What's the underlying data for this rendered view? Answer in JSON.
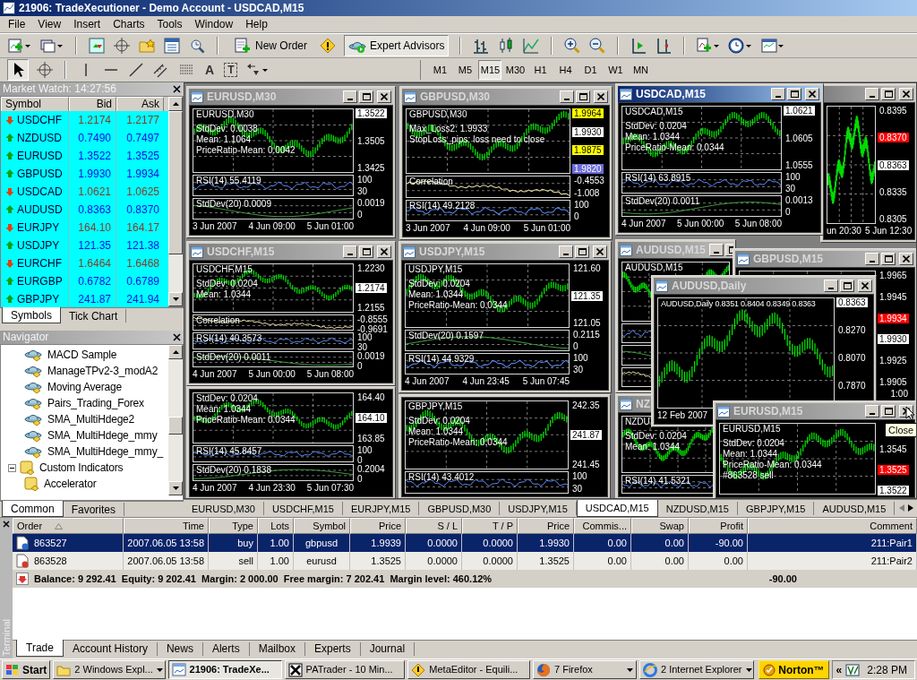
{
  "window": {
    "title": "21906: TradeXecutioner - Demo Account - USDCAD,M15"
  },
  "menu": [
    "File",
    "View",
    "Insert",
    "Charts",
    "Tools",
    "Window",
    "Help"
  ],
  "toolbar": {
    "buttons": [
      {
        "label": "New Order",
        "pressed": false
      },
      {
        "label": "Expert Advisors",
        "pressed": true
      }
    ]
  },
  "drawing_tools": [
    {
      "label": "A",
      "kind": "plain"
    },
    {
      "label": "T",
      "kind": "boxed"
    }
  ],
  "periods": [
    {
      "label": "M1",
      "selected": false
    },
    {
      "label": "M5",
      "selected": false
    },
    {
      "label": "M15",
      "selected": true
    },
    {
      "label": "M30",
      "selected": false
    },
    {
      "label": "H1",
      "selected": false
    },
    {
      "label": "H4",
      "selected": false
    },
    {
      "label": "D1",
      "selected": false
    },
    {
      "label": "W1",
      "selected": false
    },
    {
      "label": "MN",
      "selected": false
    }
  ],
  "market_watch": {
    "title": "Market Watch: 14:27:56",
    "columns": [
      "Symbol",
      "Bid",
      "Ask"
    ],
    "rows": [
      {
        "symbol": "USDCHF",
        "rising": false,
        "bid": "1.2174",
        "ask": "1.2177"
      },
      {
        "symbol": "NZDUSD",
        "rising": true,
        "bid": "0.7490",
        "ask": "0.7497"
      },
      {
        "symbol": "EURUSD",
        "rising": true,
        "bid": "1.3522",
        "ask": "1.3525"
      },
      {
        "symbol": "GBPUSD",
        "rising": true,
        "bid": "1.9930",
        "ask": "1.9934"
      },
      {
        "symbol": "USDCAD",
        "rising": false,
        "bid": "1.0621",
        "ask": "1.0625"
      },
      {
        "symbol": "AUDUSD",
        "rising": true,
        "bid": "0.8363",
        "ask": "0.8370"
      },
      {
        "symbol": "EURJPY",
        "rising": false,
        "bid": "164.10",
        "ask": "164.17"
      },
      {
        "symbol": "USDJPY",
        "rising": true,
        "bid": "121.35",
        "ask": "121.38"
      },
      {
        "symbol": "EURCHF",
        "rising": false,
        "bid": "1.6464",
        "ask": "1.6468"
      },
      {
        "symbol": "EURGBP",
        "rising": true,
        "bid": "0.6782",
        "ask": "0.6789"
      },
      {
        "symbol": "GBPJPY",
        "rising": true,
        "bid": "241.87",
        "ask": "241.94"
      }
    ],
    "tabs": [
      {
        "label": "Symbols",
        "selected": true
      },
      {
        "label": "Tick Chart",
        "selected": false
      }
    ]
  },
  "navigator": {
    "title": "Navigator",
    "items": [
      {
        "label": "MACD Sample",
        "kind": "expert"
      },
      {
        "label": "ManageTPv2-3_modA2",
        "kind": "expert"
      },
      {
        "label": "Moving Average",
        "kind": "expert"
      },
      {
        "label": "Pairs_Trading_Forex",
        "kind": "expert"
      },
      {
        "label": "SMA_MultiHdege2",
        "kind": "expert"
      },
      {
        "label": "SMA_MultiHdege_mmy",
        "kind": "expert"
      },
      {
        "label": "SMA_MultiHdege_mmy_",
        "kind": "expert"
      },
      {
        "label": "Custom Indicators",
        "kind": "folder",
        "expanded": true,
        "children": [
          {
            "label": "Accelerator",
            "kind": "indicator"
          }
        ]
      }
    ],
    "tabs": [
      {
        "label": "Common",
        "selected": true
      },
      {
        "label": "Favorites",
        "selected": false
      }
    ]
  },
  "charts": [
    {
      "title": "EURUSD,M30",
      "active": false,
      "panes": [
        {
          "kind": "main",
          "header": "EURUSD,M30",
          "lines": [
            "StdDev: 0.0038",
            "Mean: 1.1064",
            "PriceRatio-Mean: 0.0042"
          ],
          "prices": [
            {
              "text": "1.3522",
              "kind": "current"
            },
            {
              "text": "1.3505",
              "kind": "plain"
            },
            {
              "text": "1.3425",
              "kind": "plain"
            }
          ]
        },
        {
          "kind": "rsi",
          "label": "RSI(14) 55.4119",
          "prices": [
            {
              "text": "100",
              "kind": "plain"
            },
            {
              "text": "30",
              "kind": "plain"
            }
          ]
        },
        {
          "kind": "stddev",
          "label": "StdDev(20) 0.0009",
          "prices": [
            {
              "text": "0.0019",
              "kind": "plain"
            },
            {
              "text": "0",
              "kind": "plain"
            }
          ]
        }
      ],
      "dates": [
        "3 Jun 2007",
        "4 Jun 09:00",
        "5 Jun 01:00"
      ]
    },
    {
      "title": "GBPUSD,M30",
      "active": false,
      "panes": [
        {
          "kind": "main",
          "header": "GBPUSD,M30",
          "lines": [
            "Max_Loss2: 1.9933",
            "StopLoss_pips: loss need to close"
          ],
          "prices": [
            {
              "text": "1.9964",
              "kind": "yellow"
            },
            {
              "text": "1.9930",
              "kind": "current"
            },
            {
              "text": "1.9875",
              "kind": "yellow"
            },
            {
              "text": "1.9820",
              "kind": "purple"
            }
          ]
        },
        {
          "kind": "correlation",
          "label": "Correlation",
          "prices": [
            {
              "text": "-0.4553",
              "kind": "plain"
            },
            {
              "text": "-1.008",
              "kind": "plain"
            }
          ]
        },
        {
          "kind": "rsi",
          "label": "RSI(14) 49.2128",
          "prices": [
            {
              "text": "100",
              "kind": "plain"
            },
            {
              "text": "0",
              "kind": "plain"
            }
          ]
        }
      ],
      "dates": [
        "3 Jun 2007",
        "4 Jun 09:00",
        "5 Jun 01:00"
      ]
    },
    {
      "title": "USDCAD,M15",
      "active": true,
      "panes": [
        {
          "kind": "main",
          "header": "USDCAD,M15",
          "lines": [
            "StdDev: 0.0204",
            "Mean: 1.0344",
            "PriceRatio-Mean: 0.0344"
          ],
          "prices": [
            {
              "text": "1.0621",
              "kind": "current"
            },
            {
              "text": "1.0605",
              "kind": "plain"
            },
            {
              "text": "1.0555",
              "kind": "plain"
            }
          ]
        },
        {
          "kind": "rsi",
          "label": "RSI(14) 63.8915",
          "prices": [
            {
              "text": "100",
              "kind": "plain"
            },
            {
              "text": "30",
              "kind": "plain"
            }
          ]
        },
        {
          "kind": "stddev",
          "label": "StdDev(20) 0.0011",
          "prices": [
            {
              "text": "0.0013",
              "kind": "plain"
            },
            {
              "text": "0",
              "kind": "plain"
            }
          ]
        }
      ],
      "dates": [
        "4 Jun 2007",
        "5 Jun 00:00",
        "5 Jun 08:00"
      ]
    },
    {
      "active": false,
      "panes": [
        {
          "kind": "main",
          "prices": [
            {
              "text": "0.8395",
              "kind": "plain"
            },
            {
              "text": "0.8370",
              "kind": "red"
            },
            {
              "text": "0.8363",
              "kind": "current"
            },
            {
              "text": "0.8335",
              "kind": "plain"
            },
            {
              "text": "0.8305",
              "kind": "plain"
            }
          ]
        }
      ],
      "dates": [
        "un 20:30",
        "5 Jun 12:30"
      ]
    },
    {
      "title": "USDCHF,M15",
      "active": false,
      "panes": [
        {
          "kind": "main",
          "header": "USDCHF,M15",
          "lines": [
            "StdDev: 0.0204",
            "Mean: 1.0344"
          ],
          "prices": [
            {
              "text": "1.2230",
              "kind": "plain"
            },
            {
              "text": "1.2174",
              "kind": "current"
            },
            {
              "text": "1.2155",
              "kind": "plain"
            }
          ]
        },
        {
          "kind": "correlation",
          "label": "Correlation",
          "prices": [
            {
              "text": "-0.8555",
              "kind": "plain"
            },
            {
              "text": "-0.9691",
              "kind": "plain"
            }
          ]
        },
        {
          "kind": "rsi",
          "label": "RSI(14) 40.3573",
          "prices": [
            {
              "text": "100",
              "kind": "plain"
            },
            {
              "text": "30",
              "kind": "plain"
            }
          ]
        },
        {
          "kind": "stddev",
          "label": "StdDev(20) 0.0011",
          "prices": [
            {
              "text": "0.0019",
              "kind": "plain"
            },
            {
              "text": "0",
              "kind": "plain"
            }
          ]
        }
      ],
      "dates": [
        "4 Jun 2007",
        "5 Jun 00:00",
        "5 Jun 08:00"
      ]
    },
    {
      "title": "USDJPY,M15",
      "active": false,
      "panes": [
        {
          "kind": "main",
          "header": "USDJPY,M15",
          "lines": [
            "StdDev: 0.0204",
            "Mean: 1.0344",
            "PriceRatio-Mean: 0.0344"
          ],
          "prices": [
            {
              "text": "121.60",
              "kind": "plain"
            },
            {
              "text": "121.35",
              "kind": "current"
            },
            {
              "text": "121.05",
              "kind": "plain"
            }
          ]
        },
        {
          "kind": "stddev",
          "label": "StdDev(20) 0.1597",
          "prices": [
            {
              "text": "0.2115",
              "kind": "plain"
            },
            {
              "text": "0",
              "kind": "plain"
            }
          ]
        },
        {
          "kind": "rsi",
          "label": "RSI(14) 44.9329",
          "prices": [
            {
              "text": "100",
              "kind": "plain"
            },
            {
              "text": "30",
              "kind": "plain"
            }
          ]
        }
      ],
      "dates": [
        "4 Jun 2007",
        "4 Jun 23:45",
        "5 Jun 07:45"
      ]
    },
    {
      "title": "AUDUSD,M15",
      "active": false,
      "panes": [
        {
          "kind": "main",
          "header": "AUDUSD,M15"
        },
        {
          "kind": "rsi"
        },
        {
          "kind": "stddev"
        },
        {
          "kind": "correlation"
        }
      ]
    },
    {
      "title": "GBPUSD,M15",
      "active": false,
      "panes": [
        {
          "kind": "main",
          "prices": [
            {
              "text": "1.9965",
              "kind": "plain"
            },
            {
              "text": "1.9945",
              "kind": "plain"
            },
            {
              "text": "1.9934",
              "kind": "red"
            },
            {
              "text": "1.9930",
              "kind": "current"
            },
            {
              "text": "1.9925",
              "kind": "plain"
            },
            {
              "text": "1.9905",
              "kind": "plain"
            }
          ]
        }
      ],
      "dates": [
        "1:00"
      ]
    },
    {
      "title": "AUDUSD,Daily",
      "active": false,
      "panes": [
        {
          "kind": "main",
          "header": "AUDUSD,Daily 0.8351 0.8404 0.8349 0.8363",
          "prices": [
            {
              "text": "0.8363",
              "kind": "current"
            },
            {
              "text": "0.8270",
              "kind": "plain"
            },
            {
              "text": "0.8070",
              "kind": "plain"
            },
            {
              "text": "0.7870",
              "kind": "plain"
            }
          ]
        }
      ],
      "dates": [
        "12 Feb 2007"
      ]
    },
    {
      "panes": [
        {
          "kind": "main",
          "lines": [
            "StdDev: 0.0204",
            "Mean: 1.0344",
            "PriceRatio-Mean: 0.0344"
          ],
          "prices": [
            {
              "text": "164.40",
              "kind": "plain"
            },
            {
              "text": "164.10",
              "kind": "current"
            },
            {
              "text": "163.85",
              "kind": "plain"
            }
          ]
        },
        {
          "kind": "rsi",
          "label": "RSI(14) 45.8457",
          "prices": [
            {
              "text": "100",
              "kind": "plain"
            },
            {
              "text": "0",
              "kind": "plain"
            }
          ]
        },
        {
          "kind": "stddev",
          "label": "StdDev(20) 0.1838",
          "prices": [
            {
              "text": "0.2004",
              "kind": "plain"
            },
            {
              "text": "0",
              "kind": "plain"
            }
          ]
        }
      ],
      "dates": [
        "4 Jun 2007",
        "4 Jun 23:30",
        "5 Jun 07:30"
      ]
    },
    {
      "panes": [
        {
          "kind": "main",
          "header": "GBPJPY,M15",
          "lines": [
            "StdDev: 0.0204",
            "Mean: 1.0344",
            "PriceRatio-Mean: 0.0344"
          ],
          "prices": [
            {
              "text": "242.35",
              "kind": "plain"
            },
            {
              "text": "241.87",
              "kind": "current"
            },
            {
              "text": "241.45",
              "kind": "plain"
            }
          ]
        },
        {
          "kind": "rsi",
          "label": "RSI(14) 43.4012",
          "prices": [
            {
              "text": "100",
              "kind": "plain"
            },
            {
              "text": "30",
              "kind": "plain"
            }
          ]
        }
      ]
    },
    {
      "title": "NZ",
      "active": false,
      "panes": [
        {
          "kind": "main",
          "header": "NZDU",
          "lines": [
            "StdDev: 0.0204",
            "Mean: 1.0344"
          ]
        },
        {
          "kind": "rsi",
          "label": "RSI(14) 41.5321"
        }
      ]
    },
    {
      "title": "EURUSD,M15",
      "active": false,
      "panes": [
        {
          "kind": "main",
          "header": "EURUSD,M15",
          "lines": [
            "StdDev: 0.0204",
            "Mean: 1.0344",
            "PriceRatio-Mean: 0.0344",
            "#863528 sell"
          ],
          "prices": [
            {
              "text": "1.3545",
              "kind": "plain"
            },
            {
              "text": "1.3525",
              "kind": "red"
            },
            {
              "text": "1.3522",
              "kind": "current"
            }
          ]
        }
      ]
    }
  ],
  "tooltip": "Close",
  "chart_tabs": [
    {
      "label": "EURUSD,M30",
      "selected": false
    },
    {
      "label": "USDCHF,M15",
      "selected": false
    },
    {
      "label": "EURJPY,M15",
      "selected": false
    },
    {
      "label": "GBPUSD,M30",
      "selected": false
    },
    {
      "label": "USDJPY,M15",
      "selected": false
    },
    {
      "label": "USDCAD,M15",
      "selected": true
    },
    {
      "label": "NZDUSD,M15",
      "selected": false
    },
    {
      "label": "GBPJPY,M15",
      "selected": false
    },
    {
      "label": "AUDUSD,M15",
      "selected": false
    }
  ],
  "terminal": {
    "side_label": "Terminal",
    "columns": [
      "Order",
      "Time",
      "Type",
      "Lots",
      "Symbol",
      "Price",
      "S / L",
      "T / P",
      "Price",
      "Commis...",
      "Swap",
      "Profit",
      "Comment"
    ],
    "rows": [
      {
        "kind": "buy",
        "selected": true,
        "cells": [
          "863527",
          "2007.06.05 13:58",
          "buy",
          "1.00",
          "gbpusd",
          "1.9939",
          "0.0000",
          "0.0000",
          "1.9930",
          "0.00",
          "0.00",
          "-90.00",
          "211:Pair1"
        ]
      },
      {
        "kind": "sell",
        "selected": false,
        "cells": [
          "863528",
          "2007.06.05 13:58",
          "sell",
          "1.00",
          "eurusd",
          "1.3525",
          "0.0000",
          "0.0000",
          "1.3525",
          "0.00",
          "0.00",
          "0.00",
          "211:Pair2"
        ]
      }
    ],
    "summary": "Balance: 9 292.41  Equity: 9 202.41  Margin: 2 000.00  Free margin: 7 202.41  Margin level: 460.12%",
    "summary_profit": "-90.00",
    "tabs": [
      {
        "label": "Trade",
        "selected": true
      },
      {
        "label": "Account History",
        "selected": false
      },
      {
        "label": "News",
        "selected": false
      },
      {
        "label": "Alerts",
        "selected": false
      },
      {
        "label": "Mailbox",
        "selected": false
      },
      {
        "label": "Experts",
        "selected": false
      },
      {
        "label": "Journal",
        "selected": false
      }
    ]
  },
  "taskbar": {
    "start": "Start",
    "items": [
      {
        "label": "2 Windows Expl...",
        "kind": "folder",
        "selected": false,
        "group": true
      },
      {
        "label": "21906: TradeXe...",
        "kind": "chart",
        "selected": true,
        "group": false
      },
      {
        "label": "PATrader - 10 Min...",
        "kind": "x",
        "selected": false,
        "group": false
      },
      {
        "label": "MetaEditor - Equili...",
        "kind": "warning",
        "selected": false,
        "group": false
      },
      {
        "label": "7 Firefox",
        "kind": "firefox",
        "selected": false,
        "group": true
      },
      {
        "label": "2 Internet Explorer",
        "kind": "ie",
        "selected": false,
        "group": true
      }
    ],
    "norton": "Norton™",
    "chevron": "«",
    "clock": "2:28 PM"
  }
}
